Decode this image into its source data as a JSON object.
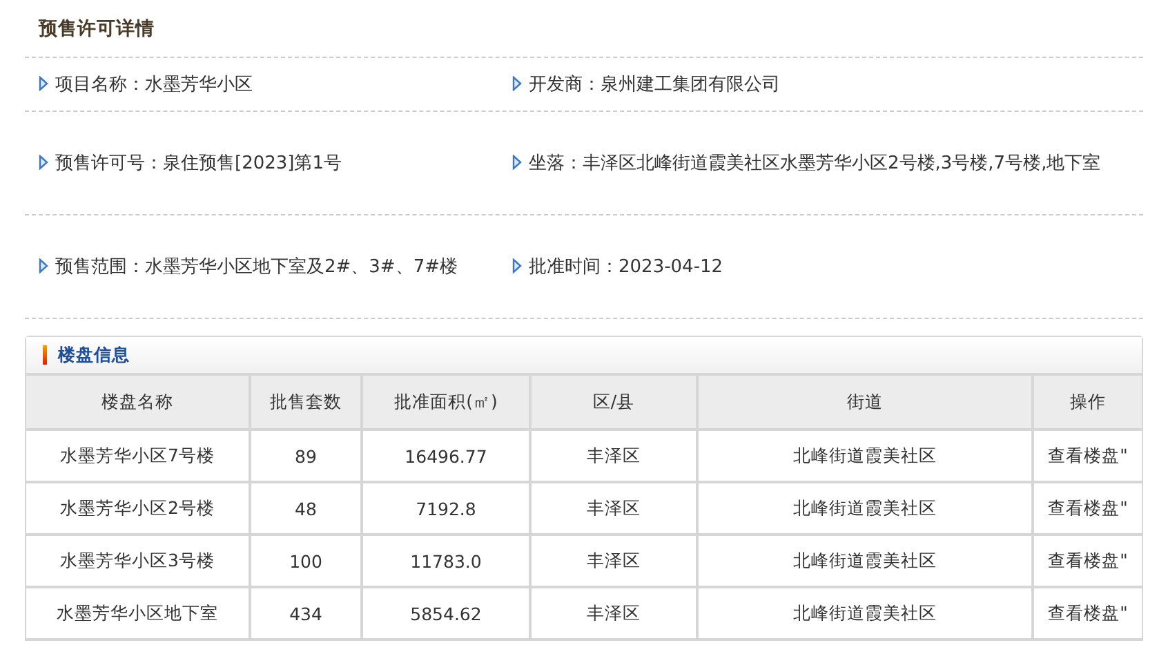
{
  "title": "预售许可详情",
  "info_rows": [
    [
      {
        "label": "项目名称：",
        "value": "水墨芳华小区"
      },
      {
        "label": "开发商：",
        "value": "泉州建工集团有限公司"
      }
    ],
    [
      {
        "label": "预售许可号：",
        "value": "泉住预售[2023]第1号"
      },
      {
        "label": "坐落：",
        "value": "丰泽区北峰街道霞美社区水墨芳华小区2号楼,3号楼,7号楼,地下室"
      }
    ],
    [
      {
        "label": "预售范围：",
        "value": "水墨芳华小区地下室及2#、3#、7#楼"
      },
      {
        "label": "批准时间：",
        "value": "2023-04-12"
      }
    ]
  ],
  "table": {
    "title": "楼盘信息",
    "columns": [
      "楼盘名称",
      "批售套数",
      "批准面积(㎡)",
      "区/县",
      "街道",
      "操作"
    ],
    "rows": [
      [
        "水墨芳华小区7号楼",
        "89",
        "16496.77",
        "丰泽区",
        "北峰街道霞美社区",
        "查看楼盘\""
      ],
      [
        "水墨芳华小区2号楼",
        "48",
        "7192.8",
        "丰泽区",
        "北峰街道霞美社区",
        "查看楼盘\""
      ],
      [
        "水墨芳华小区3号楼",
        "100",
        "11783.0",
        "丰泽区",
        "北峰街道霞美社区",
        "查看楼盘\""
      ],
      [
        "水墨芳华小区地下室",
        "434",
        "5854.62",
        "丰泽区",
        "北峰街道霞美社区",
        "查看楼盘\""
      ]
    ]
  }
}
